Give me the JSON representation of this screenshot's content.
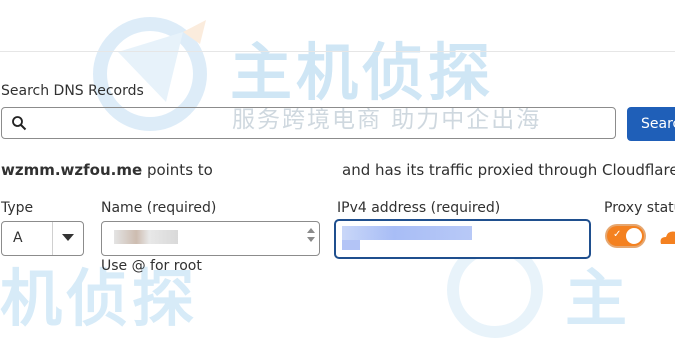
{
  "watermark": {
    "title": "主机侦探",
    "subtitle": "服务跨境电商 助力中企出海",
    "bottom_left": "机侦探",
    "bottom_right": "主"
  },
  "search": {
    "label": "Search DNS Records",
    "value": "",
    "placeholder": "",
    "button_label": "Search"
  },
  "record_summary": {
    "domain": "wzmm.wzfou.me",
    "points_to": "points to",
    "proxy_text": "and has its traffic proxied through Cloudflare."
  },
  "form": {
    "type_label": "Type",
    "type_value": "A",
    "name_label": "Name (required)",
    "name_hint": "Use @ for root",
    "ip_label": "IPv4 address (required)",
    "proxy_label": "Proxy status",
    "proxy_enabled": true
  },
  "colors": {
    "accent": "#1f5fb8",
    "proxy_orange": "#f48120",
    "focus_border": "#1f4f8e"
  },
  "icons": {
    "search": "search-icon",
    "dropdown": "chevron-down-icon",
    "proxy": "cloud-icon"
  }
}
